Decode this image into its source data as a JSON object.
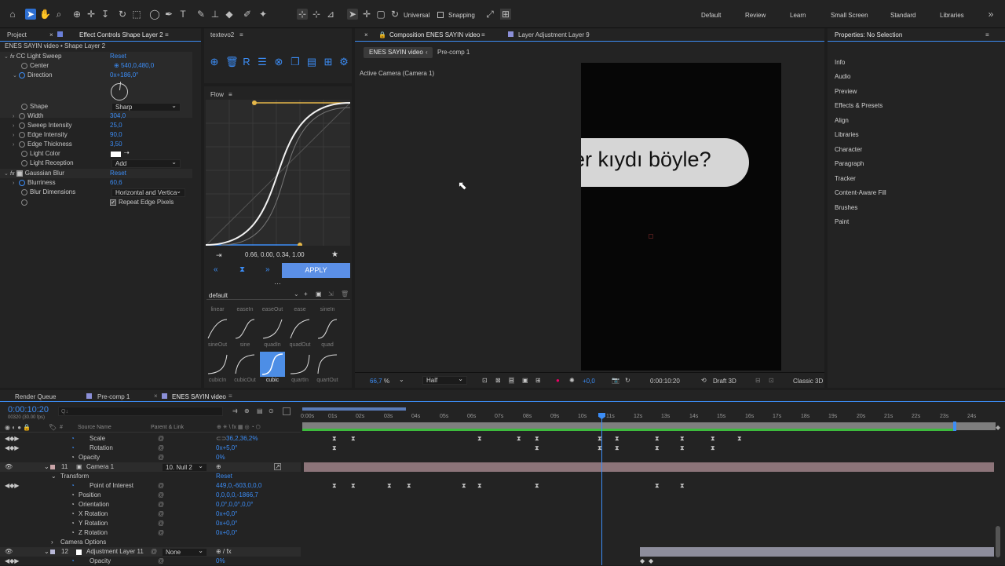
{
  "toolbar": {
    "universal_label": "Universal",
    "snapping_label": "Snapping",
    "workspaces": [
      "Default",
      "Review",
      "Learn",
      "Small Screen",
      "Standard",
      "Libraries"
    ]
  },
  "effects_panel": {
    "project_tab": "Project",
    "effect_controls_tab": "Effect Controls Shape Layer 2",
    "layer_path": "ENES SAYIN video • Shape Layer 2",
    "cc_light_sweep": "CC Light Sweep",
    "reset": "Reset",
    "props": [
      {
        "label": "Center",
        "value": "540,0,480,0"
      },
      {
        "label": "Direction",
        "value": "0x+186,0°"
      },
      {
        "label": "Shape",
        "value": "Sharp"
      },
      {
        "label": "Width",
        "value": "304,0"
      },
      {
        "label": "Sweep Intensity",
        "value": "25,0"
      },
      {
        "label": "Edge Intensity",
        "value": "90,0"
      },
      {
        "label": "Edge Thickness",
        "value": "3,50"
      },
      {
        "label": "Light Color",
        "value": ""
      },
      {
        "label": "Light Reception",
        "value": "Add"
      }
    ],
    "gaussian_blur": "Gaussian Blur",
    "blurriness_label": "Blurriness",
    "blurriness_value": "60,6",
    "blur_dimensions_label": "Blur Dimensions",
    "blur_dimensions_value": "Horizontal and Vertica",
    "repeat_edge_label": "Repeat Edge Pixels"
  },
  "textevo": {
    "tab": "textevo2"
  },
  "flow": {
    "tab": "Flow",
    "bezier": "0.66, 0.00, 0.34, 1.00",
    "apply": "APPLY",
    "preset_set": "default",
    "row0_labels": [
      "linear",
      "easeIn",
      "easeOut",
      "ease",
      "sineIn"
    ],
    "row1_labels": [
      "sineOut",
      "sine",
      "quadIn",
      "quadOut",
      "quad"
    ],
    "row2_labels": [
      "cubicIn",
      "cubicOut",
      "cubic",
      "quartIn",
      "quartOut"
    ]
  },
  "composition": {
    "tab": "Composition ENES SAYIN video",
    "layer_tab": "Layer Adjustment Layer 9",
    "crumb_active": "ENES SAYIN video",
    "crumb_next": "Pre-comp 1",
    "active_camera": "Active Camera (Camera 1)",
    "caption": "er kıydı böyle?",
    "zoom": "66,7",
    "zoom_unit": "%",
    "resolution": "Half",
    "exposure": "+0,0",
    "timecode": "0:00:10:20",
    "draft": "Draft 3D",
    "renderer": "Classic 3D"
  },
  "properties": {
    "title": "Properties: No Selection",
    "items": [
      "Info",
      "Audio",
      "Preview",
      "Effects & Presets",
      "Align",
      "Libraries",
      "Character",
      "Paragraph",
      "Tracker",
      "Content-Aware Fill",
      "Brushes",
      "Paint"
    ]
  },
  "timeline": {
    "tabs": [
      "Render Queue",
      "Pre-comp 1",
      "ENES SAYIN video"
    ],
    "timecode": "0:00:10:20",
    "frames": "00320 (30.00 fps)",
    "search_placeholder": "Q↓",
    "col_hash": "#",
    "col_source": "Source Name",
    "col_parent": "Parent & Link",
    "ruler": [
      "0:00s",
      "01s",
      "02s",
      "03s",
      "04s",
      "05s",
      "06s",
      "07s",
      "08s",
      "09s",
      "10s",
      "11s",
      "12s",
      "13s",
      "14s",
      "15s",
      "16s",
      "17s",
      "18s",
      "19s",
      "20s",
      "21s",
      "22s",
      "23s",
      "24s"
    ],
    "rows": [
      {
        "num": "",
        "label": "Scale",
        "value": "36,2,36,2%",
        "kind": "prop"
      },
      {
        "num": "",
        "label": "Rotation",
        "value": "0x+5,0°",
        "kind": "prop"
      },
      {
        "num": "",
        "label": "Opacity",
        "value": "0%",
        "kind": "prop"
      },
      {
        "num": "11",
        "label": "Camera 1",
        "value": "10. Null 2",
        "kind": "layer"
      },
      {
        "num": "",
        "label": "Transform",
        "value": "Reset",
        "kind": "group"
      },
      {
        "num": "",
        "label": "Point of Interest",
        "value": "449,0,-603,0,0,0",
        "kind": "prop"
      },
      {
        "num": "",
        "label": "Position",
        "value": "0,0,0,0,-1866,7",
        "kind": "prop"
      },
      {
        "num": "",
        "label": "Orientation",
        "value": "0,0°,0,0°,0,0°",
        "kind": "prop"
      },
      {
        "num": "",
        "label": "X Rotation",
        "value": "0x+0,0°",
        "kind": "prop"
      },
      {
        "num": "",
        "label": "Y Rotation",
        "value": "0x+0,0°",
        "kind": "prop"
      },
      {
        "num": "",
        "label": "Z Rotation",
        "value": "0x+0,0°",
        "kind": "prop"
      },
      {
        "num": "",
        "label": "Camera Options",
        "value": "",
        "kind": "group"
      },
      {
        "num": "12",
        "label": "Adjustment Layer 11",
        "value": "None",
        "kind": "layer"
      },
      {
        "num": "",
        "label": "Opacity",
        "value": "0%",
        "kind": "prop"
      }
    ]
  },
  "colors": {
    "accent": "#2d6fd2",
    "keyline": "#3c8df6",
    "green_bar": "#3dbb3d",
    "camera_bar": "#8c7479"
  }
}
